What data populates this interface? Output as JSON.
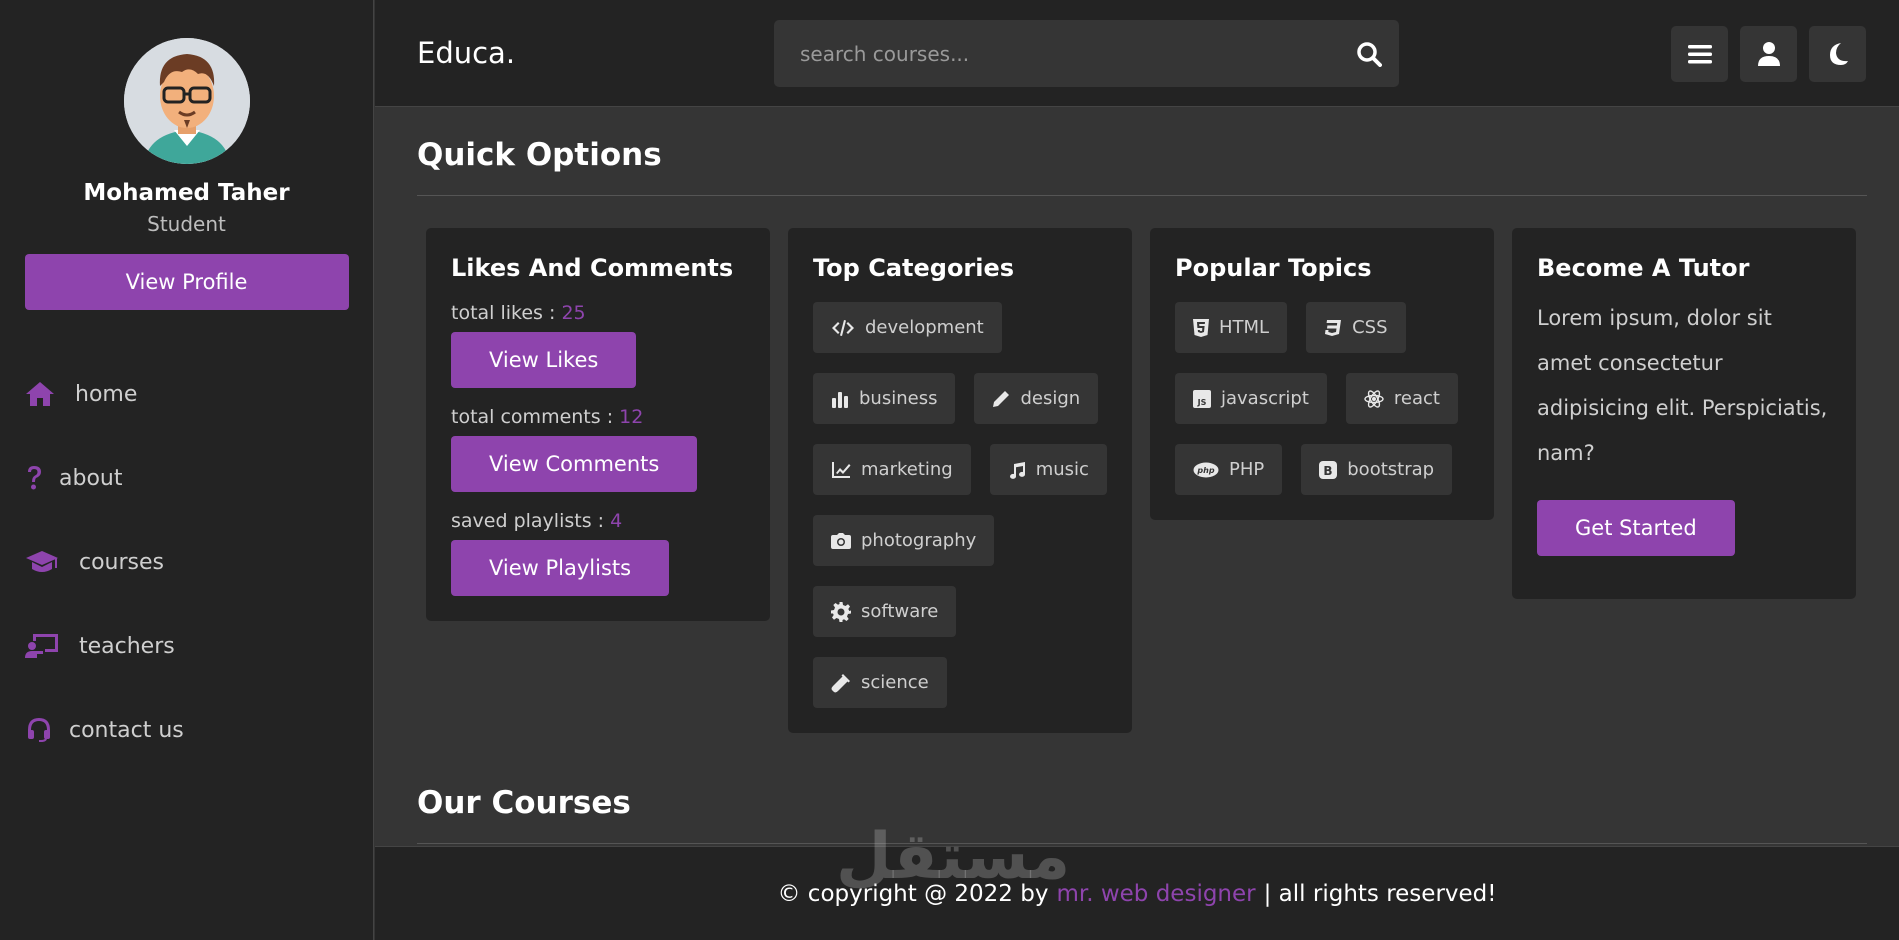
{
  "sidebar": {
    "profile": {
      "name": "Mohamed Taher",
      "role": "Student",
      "button": "View Profile"
    },
    "items": [
      {
        "label": "home",
        "icon": "home-icon"
      },
      {
        "label": "about",
        "icon": "question-icon"
      },
      {
        "label": "courses",
        "icon": "graduation-cap-icon"
      },
      {
        "label": "teachers",
        "icon": "teacher-icon"
      },
      {
        "label": "contact us",
        "icon": "headset-icon"
      }
    ]
  },
  "header": {
    "logo": "Educa.",
    "search_placeholder": "search courses...",
    "icons": [
      "menu-icon",
      "user-icon",
      "moon-icon"
    ]
  },
  "main": {
    "quick_options_title": "Quick Options",
    "likes_card": {
      "title": "Likes And Comments",
      "likes_label": "total likes :",
      "likes_value": "25",
      "likes_button": "View Likes",
      "comments_label": "total comments :",
      "comments_value": "12",
      "comments_button": "View Comments",
      "playlists_label": "saved playlists :",
      "playlists_value": "4",
      "playlists_button": "View Playlists"
    },
    "categories_card": {
      "title": "Top Categories",
      "tags": [
        "development",
        "business",
        "design",
        "marketing",
        "music",
        "photography",
        "software",
        "science"
      ]
    },
    "topics_card": {
      "title": "Popular Topics",
      "tags": [
        "HTML",
        "CSS",
        "javascript",
        "react",
        "PHP",
        "bootstrap"
      ]
    },
    "tutor_card": {
      "title": "Become A Tutor",
      "text": "Lorem ipsum, dolor sit amet consectetur adipisicing elit. Perspiciatis, nam?",
      "button": "Get Started"
    },
    "courses_title": "Our Courses"
  },
  "footer": {
    "prefix": "© copyright @ 2022 by",
    "author": "mr. web designer",
    "suffix": "| all rights reserved!"
  },
  "watermark": "مستقل",
  "colors": {
    "accent": "#8e44ad",
    "panel": "#232323",
    "background": "#353535"
  }
}
